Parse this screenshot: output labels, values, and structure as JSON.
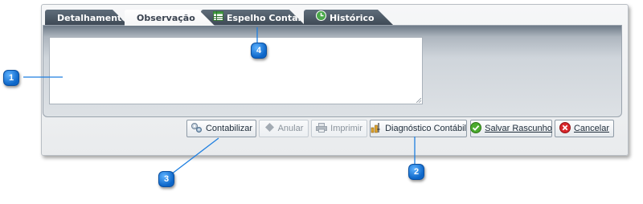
{
  "tabs": [
    {
      "label": "Detalhamento",
      "active": false,
      "icon": null
    },
    {
      "label": "Observação",
      "active": true,
      "icon": null
    },
    {
      "label": "Espelho Contábil",
      "active": false,
      "icon": "spreadsheet-icon"
    },
    {
      "label": "Histórico",
      "active": false,
      "icon": "history-icon"
    }
  ],
  "observation": {
    "value": ""
  },
  "buttons": {
    "contabilizar": {
      "label": "Contabilizar",
      "enabled": true,
      "icon": "gears-icon"
    },
    "anular": {
      "label": "Anular",
      "enabled": false,
      "icon": "diamond-icon"
    },
    "imprimir": {
      "label": "Imprimir",
      "enabled": false,
      "icon": "printer-icon"
    },
    "diagnostico": {
      "label": "Diagnóstico Contábil",
      "enabled": true,
      "icon": "diagnostic-icon"
    },
    "salvar": {
      "label": "Salvar Rascunho",
      "enabled": true,
      "icon": "check-icon"
    },
    "cancelar": {
      "label": "Cancelar",
      "enabled": true,
      "icon": "cancel-icon"
    }
  },
  "callouts": [
    "1",
    "2",
    "3",
    "4"
  ]
}
